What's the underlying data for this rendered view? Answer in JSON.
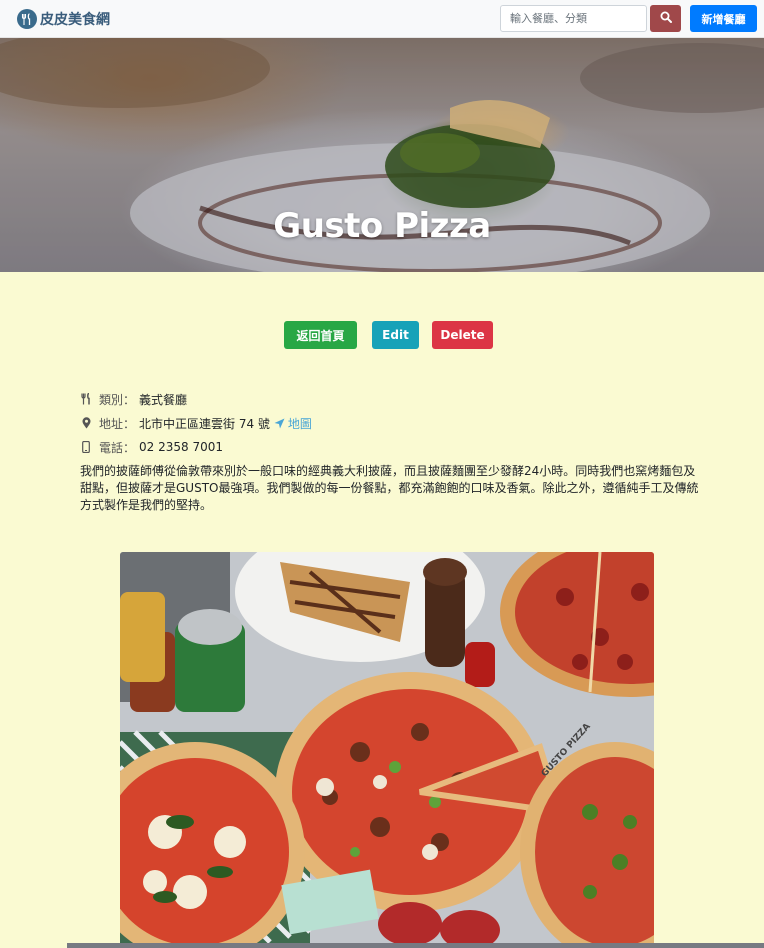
{
  "navbar": {
    "brand": "皮皮美食網",
    "search_placeholder": "輸入餐廳、分類",
    "new_button": "新增餐廳"
  },
  "restaurant": {
    "name": "Gusto Pizza",
    "category_label": "類別：",
    "category": "義式餐廳",
    "address_label": "地址：",
    "address": "北市中正區連雲街 74 號",
    "map_link": "地圖",
    "phone_label": "電話：",
    "phone": "02 2358 7001",
    "description": "我們的披薩師傅從倫敦帶來別於一般口味的經典義大利披薩，而且披薩麵團至少發酵24小時。同時我們也窯烤麵包及甜點，但披薩才是GUSTO最強項。我們製做的每一份餐點，都充滿飽飽的口味及香氣。除此之外，遵循純手工及傳統方式製作是我們的堅持。",
    "photo_text": "GUSTO PIZZA"
  },
  "actions": {
    "home": "返回首頁",
    "edit": "Edit",
    "delete": "Delete"
  },
  "colors": {
    "page_background": "#fafad2",
    "home_button": "#28a745",
    "edit_button": "#17a2b8",
    "delete_button": "#dc3545",
    "new_button": "#007bff",
    "search_button": "#a0484a",
    "link": "#4aa6d6"
  },
  "icons": {
    "brand": "utensils-icon",
    "search": "search-icon",
    "category": "utensils-icon",
    "address": "map-marker-icon",
    "phone": "mobile-phone-icon",
    "map": "location-arrow-icon"
  }
}
